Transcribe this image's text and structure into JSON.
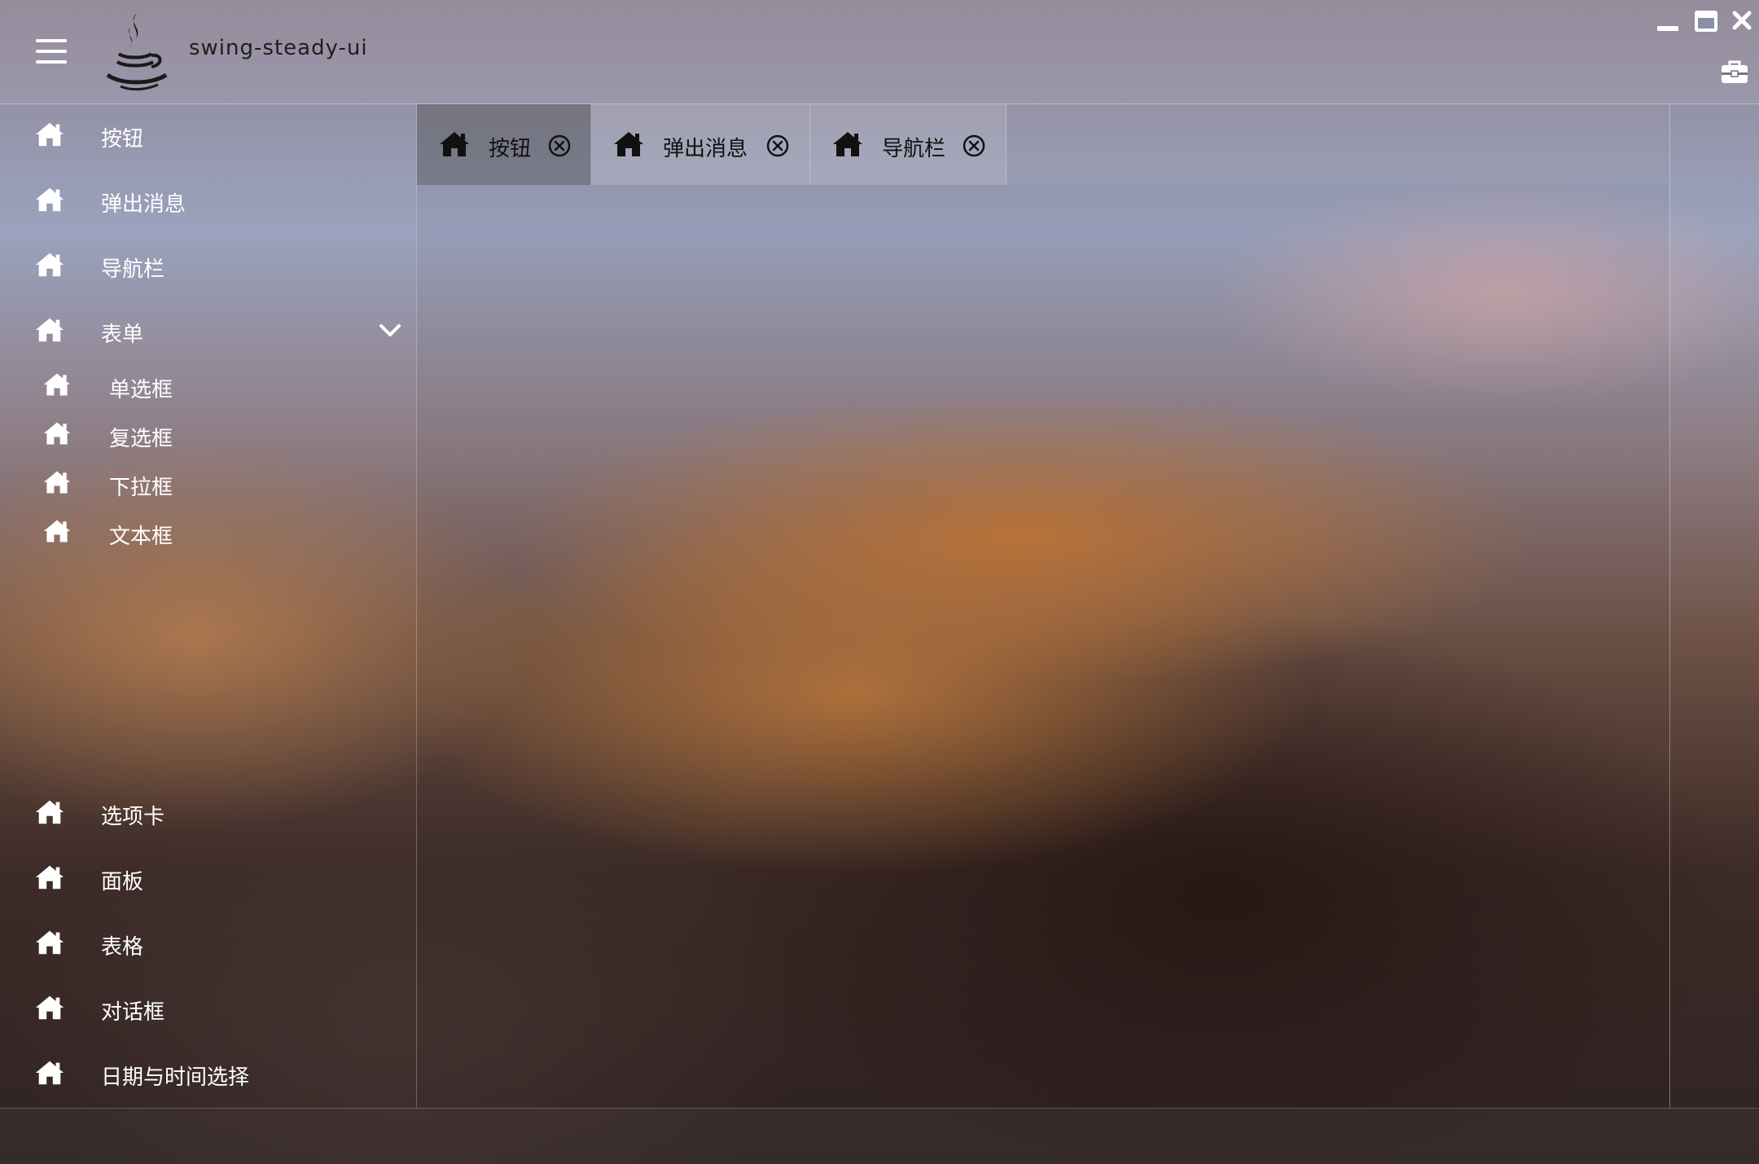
{
  "window": {
    "app_title": "swing-steady-ui",
    "controls": [
      "minimize-icon",
      "maximize-icon",
      "close-icon",
      "toolbox-icon"
    ]
  },
  "sidebar": {
    "items": [
      {
        "label": "按钮",
        "icon": "home-icon"
      },
      {
        "label": "弹出消息",
        "icon": "home-icon"
      },
      {
        "label": "导航栏",
        "icon": "home-icon"
      },
      {
        "label": "表单",
        "icon": "home-icon",
        "expanded": true,
        "children": [
          {
            "label": "单选框",
            "icon": "home-icon"
          },
          {
            "label": "复选框",
            "icon": "home-icon"
          },
          {
            "label": "下拉框",
            "icon": "home-icon"
          },
          {
            "label": "文本框",
            "icon": "home-icon"
          }
        ]
      },
      {
        "label": "选项卡",
        "icon": "home-icon"
      },
      {
        "label": "面板",
        "icon": "home-icon"
      },
      {
        "label": "表格",
        "icon": "home-icon"
      },
      {
        "label": "对话框",
        "icon": "home-icon"
      },
      {
        "label": "日期与时间选择",
        "icon": "home-icon"
      }
    ]
  },
  "tabs": [
    {
      "label": "按钮",
      "active": true
    },
    {
      "label": "弹出消息",
      "active": false
    },
    {
      "label": "导航栏",
      "active": false
    }
  ],
  "colors": {
    "text_light": "#ffffff",
    "text_dark": "#111111"
  }
}
